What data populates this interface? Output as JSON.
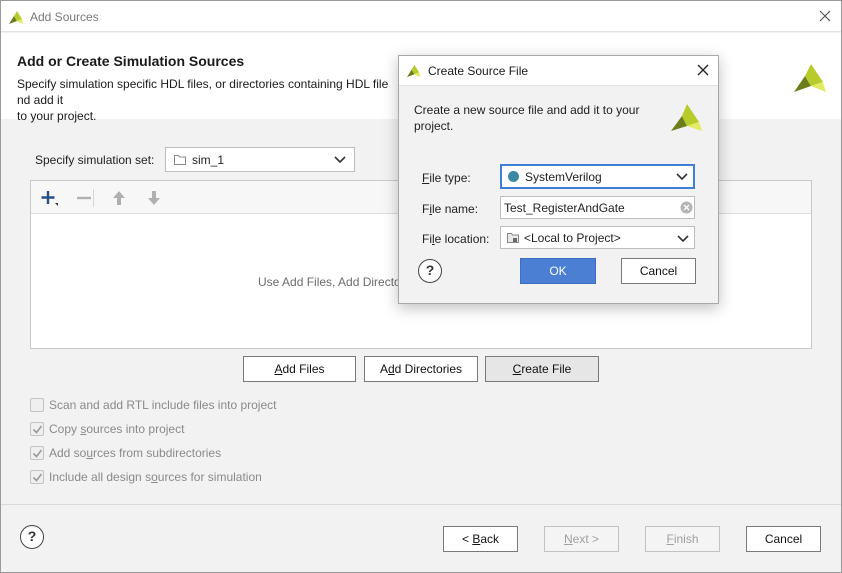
{
  "window": {
    "title": "Add Sources",
    "heading": "Add or Create Simulation Sources",
    "description": "Specify simulation specific HDL files, or directories containing HDL files, to add to your project. Create a new source file on disk and add it to your project."
  },
  "simset": {
    "label": "Specify simulation set:",
    "value": "sim_1"
  },
  "file_panel": {
    "hint": "Use Add Files, Add Directories or Create File buttons below"
  },
  "panel_buttons": {
    "add_files": "Add Files",
    "add_directories": "Add Directories",
    "create_file": "Create File"
  },
  "options": [
    {
      "label": "Scan and add RTL include files into project",
      "checked": false
    },
    {
      "label": "Copy sources into project",
      "checked": true
    },
    {
      "label": "Add sources from subdirectories",
      "checked": true
    },
    {
      "label": "Include all design sources for simulation",
      "checked": true
    }
  ],
  "footer": {
    "help": "?",
    "back": "< Back",
    "next": "Next >",
    "finish": "Finish",
    "cancel": "Cancel"
  },
  "dialog": {
    "title": "Create Source File",
    "description": "Create a new source file and add it to your project.",
    "file_type_label": "File type:",
    "file_type_value": "SystemVerilog",
    "file_name_label": "File name:",
    "file_name_value": "Test_RegisterAndGate",
    "file_location_label": "File location:",
    "file_location_value": "<Local to Project>",
    "help": "?",
    "ok": "OK",
    "cancel": "Cancel"
  },
  "colors": {
    "accent": "#4a7fd4",
    "logo_green": "#b7cc2b",
    "logo_dark": "#6e7d1b",
    "sv_dot": "#3a8aa3"
  },
  "icons": [
    "app-logo-icon",
    "close-icon",
    "folder-icon",
    "chevron-down-icon",
    "add-icon",
    "remove-icon",
    "move-up-icon",
    "move-down-icon",
    "checkmark-icon",
    "clear-icon",
    "help-icon"
  ]
}
